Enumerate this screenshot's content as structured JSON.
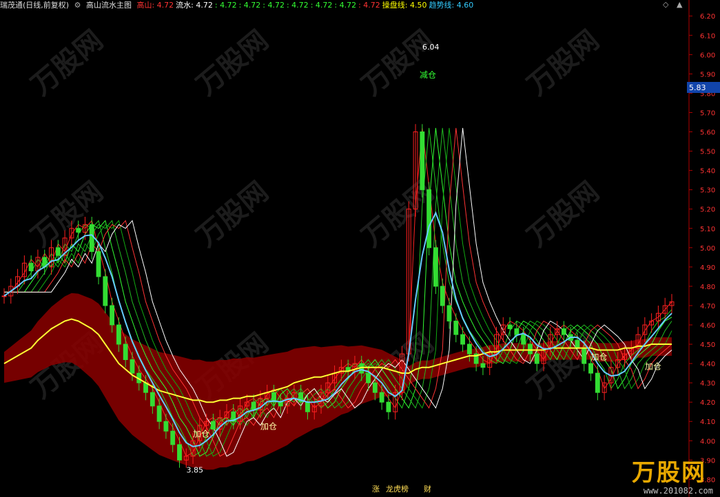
{
  "header": {
    "stock_name": "瑞茂通(日线,前复权)",
    "indicator_name": "高山流水主图",
    "items": [
      {
        "label": "高山:",
        "value": "4.72",
        "color": "#ff3333"
      },
      {
        "label": "流水:",
        "value": "4.72",
        "color": "#ffffff"
      },
      {
        "label": ":",
        "value": "4.72",
        "color": "#33ff33"
      },
      {
        "label": ":",
        "value": "4.72",
        "color": "#33ff33"
      },
      {
        "label": ":",
        "value": "4.72",
        "color": "#33ff33"
      },
      {
        "label": ":",
        "value": "4.72",
        "color": "#33ff33"
      },
      {
        "label": ":",
        "value": "4.72",
        "color": "#33ff33"
      },
      {
        "label": ":",
        "value": "4.72",
        "color": "#33ff33"
      },
      {
        "label": ":",
        "value": "4.72",
        "color": "#ff3333"
      },
      {
        "label": "操盘线:",
        "value": "4.50",
        "color": "#ffff00"
      },
      {
        "label": "趋势线:",
        "value": "4.60",
        "color": "#33ccff"
      }
    ]
  },
  "controls": {
    "diamond": "◇",
    "expand": "▲"
  },
  "current_price": "5.83",
  "annotations": {
    "high_price": "6.04",
    "low_price": "3.85",
    "reduce_label": "减仓",
    "add_label": "加仓",
    "bottom_tags": [
      "涨",
      "财",
      "龙虎榜"
    ]
  },
  "watermark": {
    "text": "万股网",
    "url": "www.201082.com"
  },
  "colors": {
    "background": "#000000",
    "up": "#ff2020",
    "down": "#33dd33",
    "ma_yellow": "#ffff33",
    "trend_cyan": "#66ccff",
    "band_red": "#8b0000",
    "band_green": "#006400"
  },
  "chart_data": {
    "type": "candlestick",
    "y_axis_ticks": [
      "6.20",
      "6.10",
      "6.00",
      "5.90",
      "5.80",
      "5.70",
      "5.60",
      "5.50",
      "5.40",
      "5.30",
      "5.20",
      "5.10",
      "5.00",
      "4.90",
      "4.80",
      "4.70",
      "4.60",
      "4.50",
      "4.40",
      "4.30",
      "4.20",
      "4.10",
      "4.00",
      "3.90",
      "3.80"
    ],
    "ylim": [
      3.78,
      6.24
    ],
    "grid": false,
    "close_series": [
      4.75,
      4.8,
      4.85,
      4.92,
      4.88,
      4.95,
      4.9,
      5.0,
      4.96,
      5.05,
      5.1,
      5.08,
      5.12,
      4.98,
      4.85,
      4.7,
      4.6,
      4.5,
      4.42,
      4.35,
      4.3,
      4.25,
      4.18,
      4.1,
      4.05,
      3.98,
      3.9,
      3.92,
      4.0,
      4.08,
      4.1,
      4.06,
      4.12,
      4.15,
      4.1,
      4.18,
      4.2,
      4.16,
      4.22,
      4.25,
      4.2,
      4.18,
      4.22,
      4.25,
      4.2,
      4.15,
      4.18,
      4.25,
      4.3,
      4.35,
      4.38,
      4.36,
      4.4,
      4.35,
      4.3,
      4.25,
      4.2,
      4.15,
      4.25,
      4.45,
      5.2,
      5.6,
      5.3,
      5.0,
      4.8,
      4.7,
      4.62,
      4.55,
      4.5,
      4.45,
      4.4,
      4.38,
      4.45,
      4.55,
      4.6,
      4.58,
      4.55,
      4.5,
      4.45,
      4.4,
      4.48,
      4.55,
      4.58,
      4.55,
      4.52,
      4.48,
      4.4,
      4.35,
      4.25,
      4.3,
      4.38,
      4.42,
      4.45,
      4.48,
      4.55,
      4.6,
      4.62,
      4.66,
      4.7,
      4.72
    ],
    "series": [
      {
        "values": [
          4.4,
          4.42,
          4.44,
          4.46,
          4.48,
          4.52,
          4.55,
          4.58,
          4.6,
          4.62,
          4.63,
          4.62,
          4.6,
          4.58,
          4.55,
          4.5,
          4.45,
          4.4,
          4.37,
          4.34,
          4.32,
          4.3,
          4.28,
          4.26,
          4.25,
          4.24,
          4.23,
          4.22,
          4.21,
          4.21,
          4.2,
          4.2,
          4.21,
          4.21,
          4.22,
          4.22,
          4.23,
          4.23,
          4.24,
          4.25,
          4.26,
          4.27,
          4.28,
          4.3,
          4.31,
          4.32,
          4.33,
          4.33,
          4.34,
          4.35,
          4.36,
          4.36,
          4.37,
          4.38,
          4.38,
          4.38,
          4.38,
          4.37,
          4.36,
          4.35,
          4.35,
          4.37,
          4.38,
          4.38,
          4.39,
          4.4,
          4.41,
          4.42,
          4.43,
          4.44,
          4.44,
          4.45,
          4.46,
          4.46,
          4.47,
          4.47,
          4.47,
          4.47,
          4.47,
          4.47,
          4.47,
          4.48,
          4.48,
          4.48,
          4.48,
          4.48,
          4.48,
          4.48,
          4.47,
          4.47,
          4.47,
          4.47,
          4.48,
          4.48,
          4.49,
          4.49,
          4.5,
          4.5,
          4.5,
          4.5
        ]
      }
    ]
  }
}
